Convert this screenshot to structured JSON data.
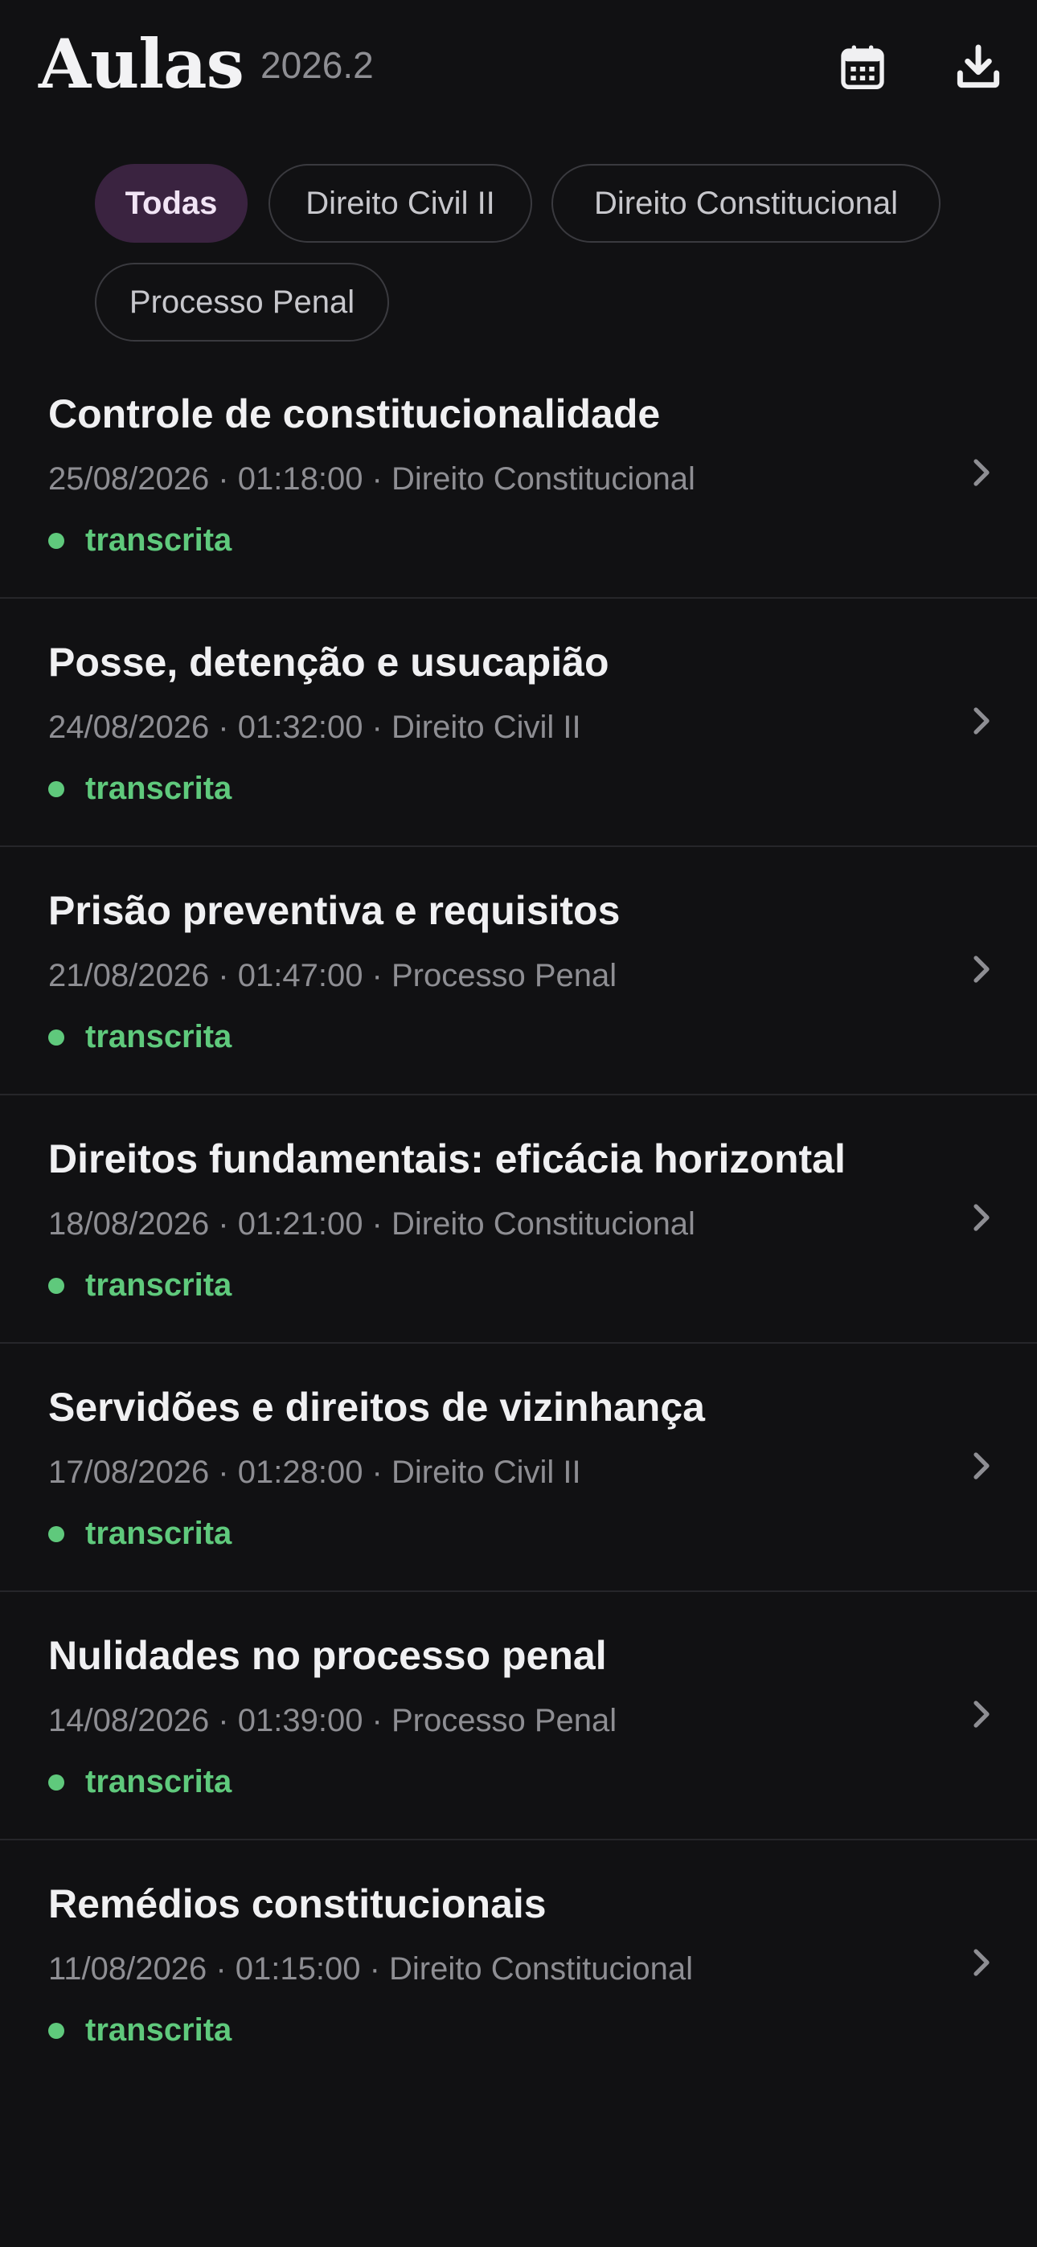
{
  "header": {
    "title": "Aulas",
    "semester": "2026.2",
    "icons": {
      "calendar": "calendar-icon",
      "download": "download-icon"
    }
  },
  "filters": [
    {
      "label": "Todas",
      "active": true
    },
    {
      "label": "Direito Civil II",
      "active": false
    },
    {
      "label": "Direito Constitucional",
      "active": false
    },
    {
      "label": "Processo Penal",
      "active": false
    }
  ],
  "lessons": [
    {
      "title": "Controle de constitucionalidade",
      "meta": "25/08/2026 · 01:18:00 · Direito Constitucional",
      "status": "transcrita"
    },
    {
      "title": "Posse, detenção e usucapião",
      "meta": "24/08/2026 · 01:32:00 · Direito Civil II",
      "status": "transcrita"
    },
    {
      "title": "Prisão preventiva e requisitos",
      "meta": "21/08/2026 · 01:47:00 · Processo Penal",
      "status": "transcrita"
    },
    {
      "title": "Direitos fundamentais: eficácia horizontal",
      "meta": "18/08/2026 · 01:21:00 · Direito Constitucional",
      "status": "transcrita"
    },
    {
      "title": "Servidões e direitos de vizinhança",
      "meta": "17/08/2026 · 01:28:00 · Direito Civil II",
      "status": "transcrita"
    },
    {
      "title": "Nulidades no processo penal",
      "meta": "14/08/2026 · 01:39:00 · Processo Penal",
      "status": "transcrita"
    },
    {
      "title": "Remédios constitucionais",
      "meta": "11/08/2026 · 01:15:00 · Direito Constitucional",
      "status": "transcrita"
    }
  ],
  "colors": {
    "background": "#111113",
    "accent_chip": "#3a2340",
    "status_green": "#5fc97c",
    "secondary_text": "#8e8e93"
  }
}
